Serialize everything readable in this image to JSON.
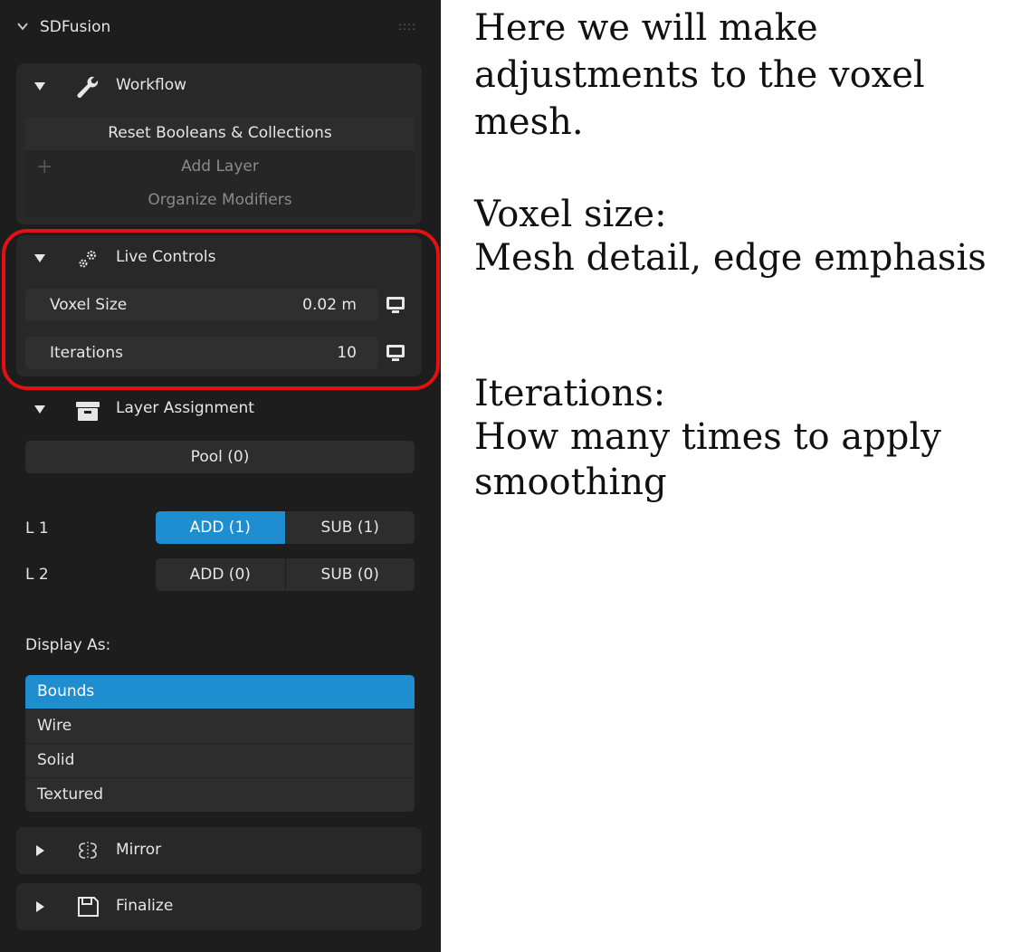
{
  "panel": {
    "title": "SDFusion",
    "grip": "::::"
  },
  "workflow": {
    "title": "Workflow",
    "reset_label": "Reset Booleans & Collections",
    "add_layer_label": "Add Layer",
    "organize_label": "Organize Modifiers",
    "plus": "+"
  },
  "live_controls": {
    "title": "Live Controls",
    "voxel_size_label": "Voxel Size",
    "voxel_size_value": "0.02 m",
    "iterations_label": "Iterations",
    "iterations_value": "10"
  },
  "layer_assignment": {
    "title": "Layer Assignment",
    "pool_label": "Pool (0)",
    "layers": [
      {
        "label": "L 1",
        "add": "ADD (1)",
        "sub": "SUB (1)",
        "add_active": true
      },
      {
        "label": "L 2",
        "add": "ADD (0)",
        "sub": "SUB (0)",
        "add_active": false
      }
    ],
    "display_as_label": "Display As:",
    "display_options": [
      "Bounds",
      "Wire",
      "Solid",
      "Textured"
    ],
    "display_selected": "Bounds"
  },
  "mirror": {
    "title": "Mirror"
  },
  "finalize": {
    "title": "Finalize"
  },
  "annotations": {
    "line1": "Here we will make",
    "line2": "adjustments to the voxel",
    "line3": "mesh.",
    "voxel_heading": "Voxel size:",
    "voxel_desc": "Mesh detail, edge emphasis",
    "iter_heading": "Iterations:",
    "iter_desc1": "How many times to apply",
    "iter_desc2": "smoothing"
  },
  "colors": {
    "panel_bg": "#1d1d1d",
    "box_bg": "#282828",
    "accent": "#1e8ed0",
    "highlight": "#e31212"
  }
}
